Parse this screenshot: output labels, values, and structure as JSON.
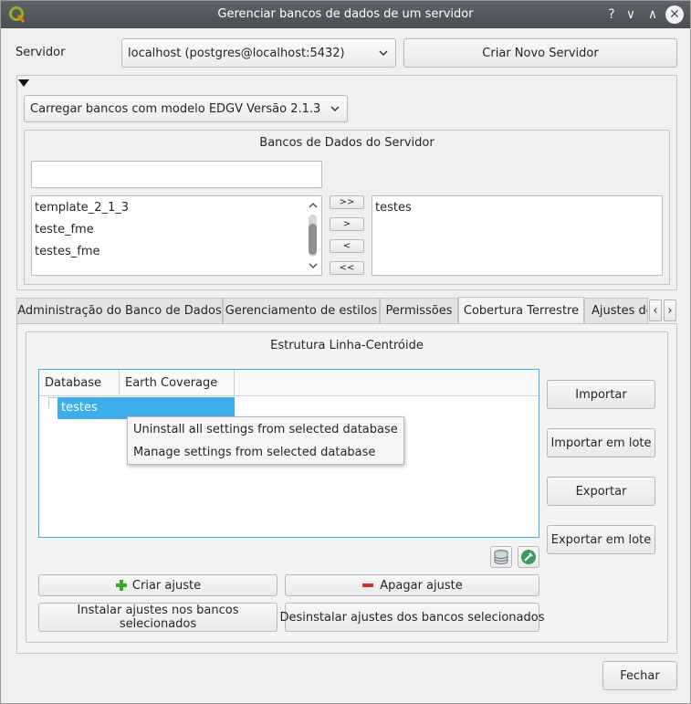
{
  "window": {
    "title": "Gerenciar bancos de dados de um servidor",
    "help_glyph": "?",
    "minimize_glyph": "∨",
    "maximize_glyph": "∧",
    "close_glyph": "✕"
  },
  "server": {
    "label": "Servidor",
    "selected": "localhost (postgres@localhost:5432)",
    "new_server_button": "Criar Novo Servidor"
  },
  "loader": {
    "selected": "Carregar bancos com modelo EDGV Versão 2.1.3"
  },
  "databases": {
    "title": "Bancos de Dados do Servidor",
    "filter_value": "",
    "available": [
      "template_2_1_3",
      "teste_fme",
      "testes_fme"
    ],
    "selected": [
      "testes"
    ],
    "move_all_right": ">>",
    "move_right": ">",
    "move_left": "<",
    "move_all_left": "<<"
  },
  "tabs": [
    {
      "label": "Administração do Banco de Dados"
    },
    {
      "label": "Gerenciamento de estilos"
    },
    {
      "label": "Permissões"
    },
    {
      "label": "Cobertura Terrestre"
    },
    {
      "label": "Ajustes de"
    }
  ],
  "tab_scroll": {
    "left": "‹",
    "right": "›"
  },
  "structure": {
    "title": "Estrutura Linha-Centróide",
    "columns": [
      "Database",
      "Earth Coverage"
    ],
    "rows": [
      {
        "database": "testes",
        "earth_coverage": ""
      }
    ],
    "context_menu": [
      "Uninstall all settings from selected database",
      "Manage settings from selected database"
    ],
    "buttons": {
      "import": "Importar",
      "batch_import": "Importar em lote",
      "export": "Exportar",
      "batch_export": "Exportar em lote",
      "create": "Criar ajuste",
      "delete": "Apagar ajuste",
      "install": "Instalar ajustes nos bancos selecionados",
      "uninstall": "Desinstalar ajustes dos bancos selecionados"
    }
  },
  "close_button": "Fechar",
  "colors": {
    "selection": "#3daee9",
    "create_icon": "#33aa22",
    "delete_icon": "#d42a2a",
    "titlebar": "#4f5256"
  }
}
